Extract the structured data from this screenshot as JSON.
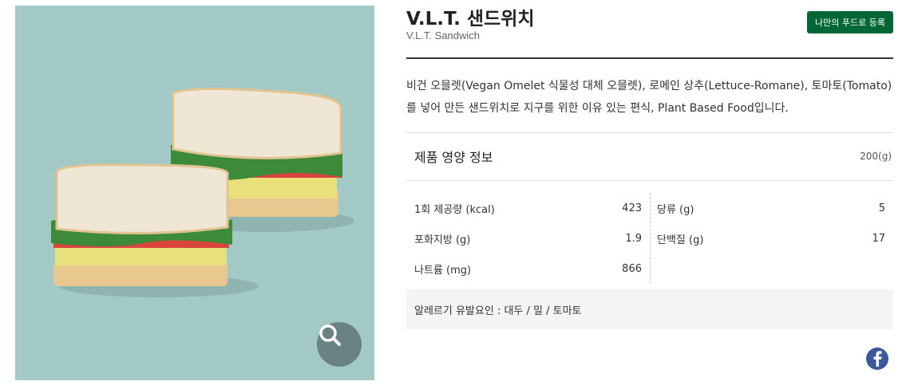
{
  "product": {
    "name_ko": "V.L.T. 샌드위치",
    "name_en": "V.L.T. Sandwich",
    "favorite_button": "나만의 푸드로 등록",
    "description": "비건 오믈렛(Vegan Omelet 식물성 대체 오믈렛), 로메인 상추(Lettuce-Romane), 토마토(Tomato)를 넣어 만든 샌드위치로 지구를 위한 이유 있는 편식, Plant Based Food입니다."
  },
  "image": {
    "icon": "zoom-search-icon"
  },
  "nutrition": {
    "title": "제품 영양 정보",
    "serving": "200(g)",
    "left": [
      {
        "label": "1회 제공량 (kcal)",
        "value": "423"
      },
      {
        "label": "포화지방 (g)",
        "value": "1.9"
      },
      {
        "label": "나트륨 (mg)",
        "value": "866"
      }
    ],
    "right": [
      {
        "label": "당류 (g)",
        "value": "5"
      },
      {
        "label": "단백질 (g)",
        "value": "17"
      }
    ]
  },
  "allergy": "알레르기 유발요인 : 대두 / 밀 / 토마토",
  "share": {
    "icon": "facebook-icon"
  },
  "colors": {
    "accent": "#006633",
    "photo_bg": "#a3c9c7",
    "facebook": "#3b5998"
  }
}
